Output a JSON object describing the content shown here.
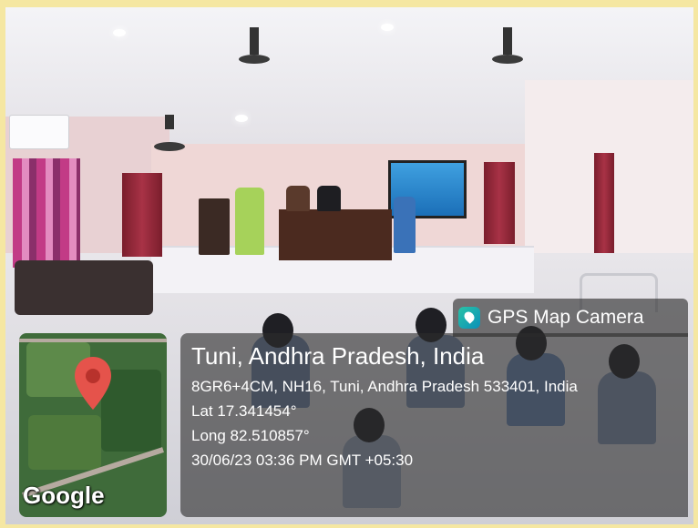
{
  "app": {
    "name": "GPS Map Camera"
  },
  "location": {
    "title": "Tuni, Andhra Pradesh, India",
    "address": "8GR6+4CM, NH16, Tuni, Andhra Pradesh 533401, India",
    "latitude": "Lat 17.341454°",
    "longitude": "Long 82.510857°",
    "datetime": "30/06/23 03:36 PM GMT +05:30"
  },
  "map": {
    "brand": "Google"
  },
  "colors": {
    "frame": "#f5e7a2",
    "overlay": "rgba(45,45,45,0.62)",
    "pin": "#e5534b"
  },
  "icons": {
    "app_icon": "map-pin-camera-icon",
    "location_pin": "location-pin-icon"
  }
}
